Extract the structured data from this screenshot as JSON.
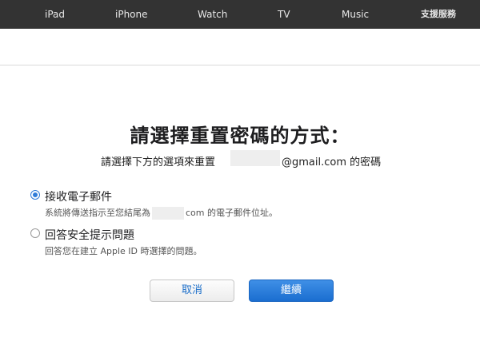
{
  "nav": {
    "ipad": "iPad",
    "iphone": "iPhone",
    "watch": "Watch",
    "tv": "TV",
    "music": "Music",
    "support": "支援服務"
  },
  "main": {
    "title": "請選擇重置密碼的方式：",
    "subtitle_prefix": "請選擇下方的選項來重置",
    "subtitle_suffix": "@gmail.com 的密碼"
  },
  "options": [
    {
      "label": "接收電子郵件",
      "desc_prefix": "系統將傳送指示至您結尾為",
      "desc_suffix": "com 的電子郵件位址。",
      "selected": true
    },
    {
      "label": "回答安全提示問題",
      "desc": "回答您在建立 Apple ID 時選擇的問題。",
      "selected": false
    }
  ],
  "buttons": {
    "cancel": "取消",
    "continue": "繼續"
  },
  "colors": {
    "nav_bg": "#333333",
    "accent": "#2f7bd8"
  }
}
